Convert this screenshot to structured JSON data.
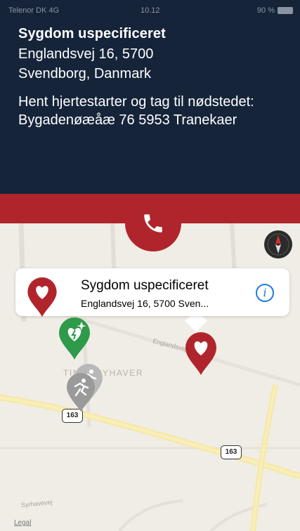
{
  "status_bar": {
    "carrier": "Telenor DK  4G",
    "time": "10.12",
    "right": "90 %"
  },
  "incident": {
    "title": "Sygdom uspecificeret",
    "address_line1": "Englandsvej 16, 5700",
    "address_line2": "Svendborg, Danmark",
    "instruction": "Hent hjertestarter og tag til nødstedet: Bygadenøæåæ 76 5953 Tranekaer"
  },
  "callout": {
    "title": "Sygdom uspecificeret",
    "subtitle": "Englandsvej 16, 5700 Sven..."
  },
  "map": {
    "area_label": "TINGGRYHAVER",
    "street_label_1": "Englandsvej",
    "street_label_2": "Syrhavevej",
    "road_sign_1": "163",
    "road_sign_2": "163",
    "legal": "Legal"
  },
  "colors": {
    "header_bg": "#16243a",
    "accent_red": "#b0252b",
    "aed_green": "#2e9a4a",
    "responder_gray": "#9a9a9a",
    "info_blue": "#1f7ae0"
  },
  "icons": {
    "call": "phone-icon",
    "compass": "compass-icon",
    "incident": "heart-pin-icon",
    "aed": "aed-pin-icon",
    "responder": "runner-pin-icon",
    "info": "info-icon"
  }
}
